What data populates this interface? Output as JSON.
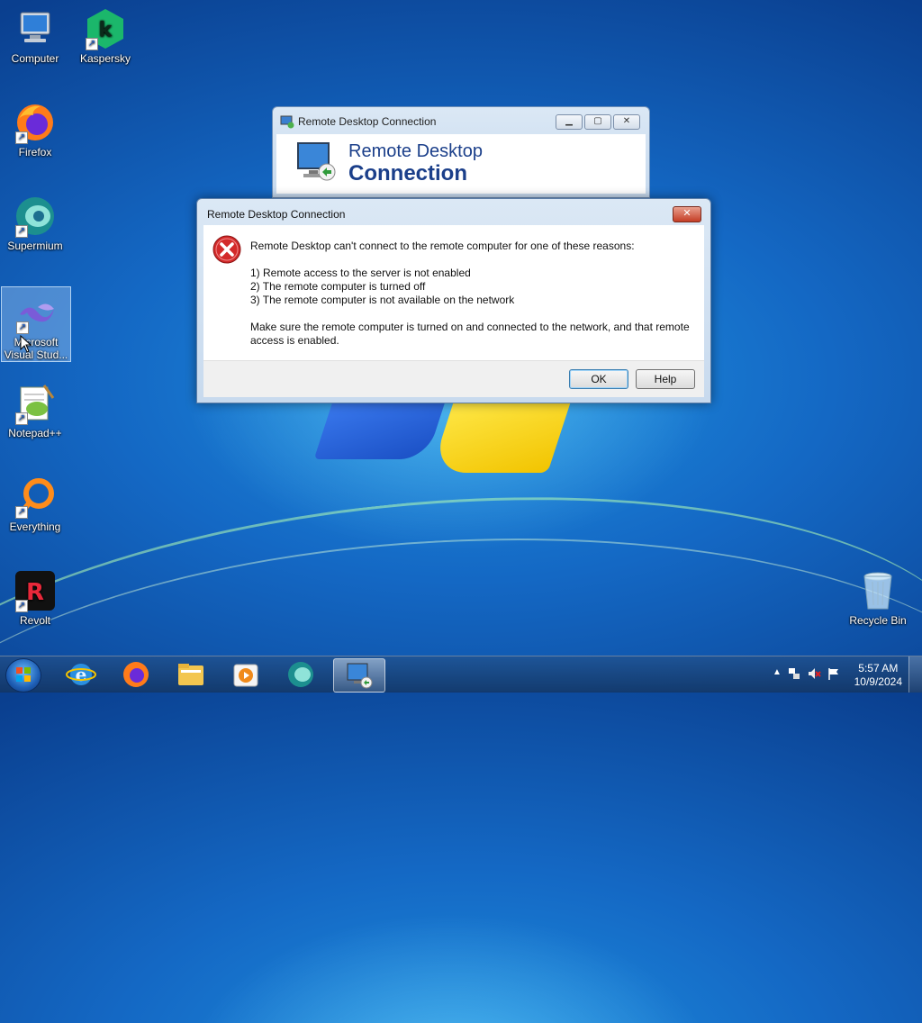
{
  "desktop": {
    "icons": [
      {
        "label": "Computer"
      },
      {
        "label": "Kaspersky"
      },
      {
        "label": "Firefox"
      },
      {
        "label": "Supermium"
      },
      {
        "label": "Microsoft Visual Stud..."
      },
      {
        "label": "Notepad++"
      },
      {
        "label": "Everything"
      },
      {
        "label": "Revolt"
      },
      {
        "label": "Recycle Bin"
      }
    ]
  },
  "back_window": {
    "title": "Remote Desktop Connection",
    "banner_line1": "Remote Desktop",
    "banner_line2": "Connection"
  },
  "dialog": {
    "title": "Remote Desktop Connection",
    "close_label": "✕",
    "intro": "Remote Desktop can't connect to the remote computer for one of these reasons:",
    "reasons": [
      "1) Remote access to the server is not enabled",
      "2) The remote computer is turned off",
      "3) The remote computer is not available on the network"
    ],
    "advice": "Make sure the remote computer is turned on and connected to the network, and that remote access is enabled.",
    "ok_label": "OK",
    "help_label": "Help"
  },
  "taskbar": {
    "time": "5:57 AM",
    "date": "10/9/2024"
  },
  "colors": {
    "error_red": "#d32a2a",
    "title_blue": "#1b3f8a"
  }
}
